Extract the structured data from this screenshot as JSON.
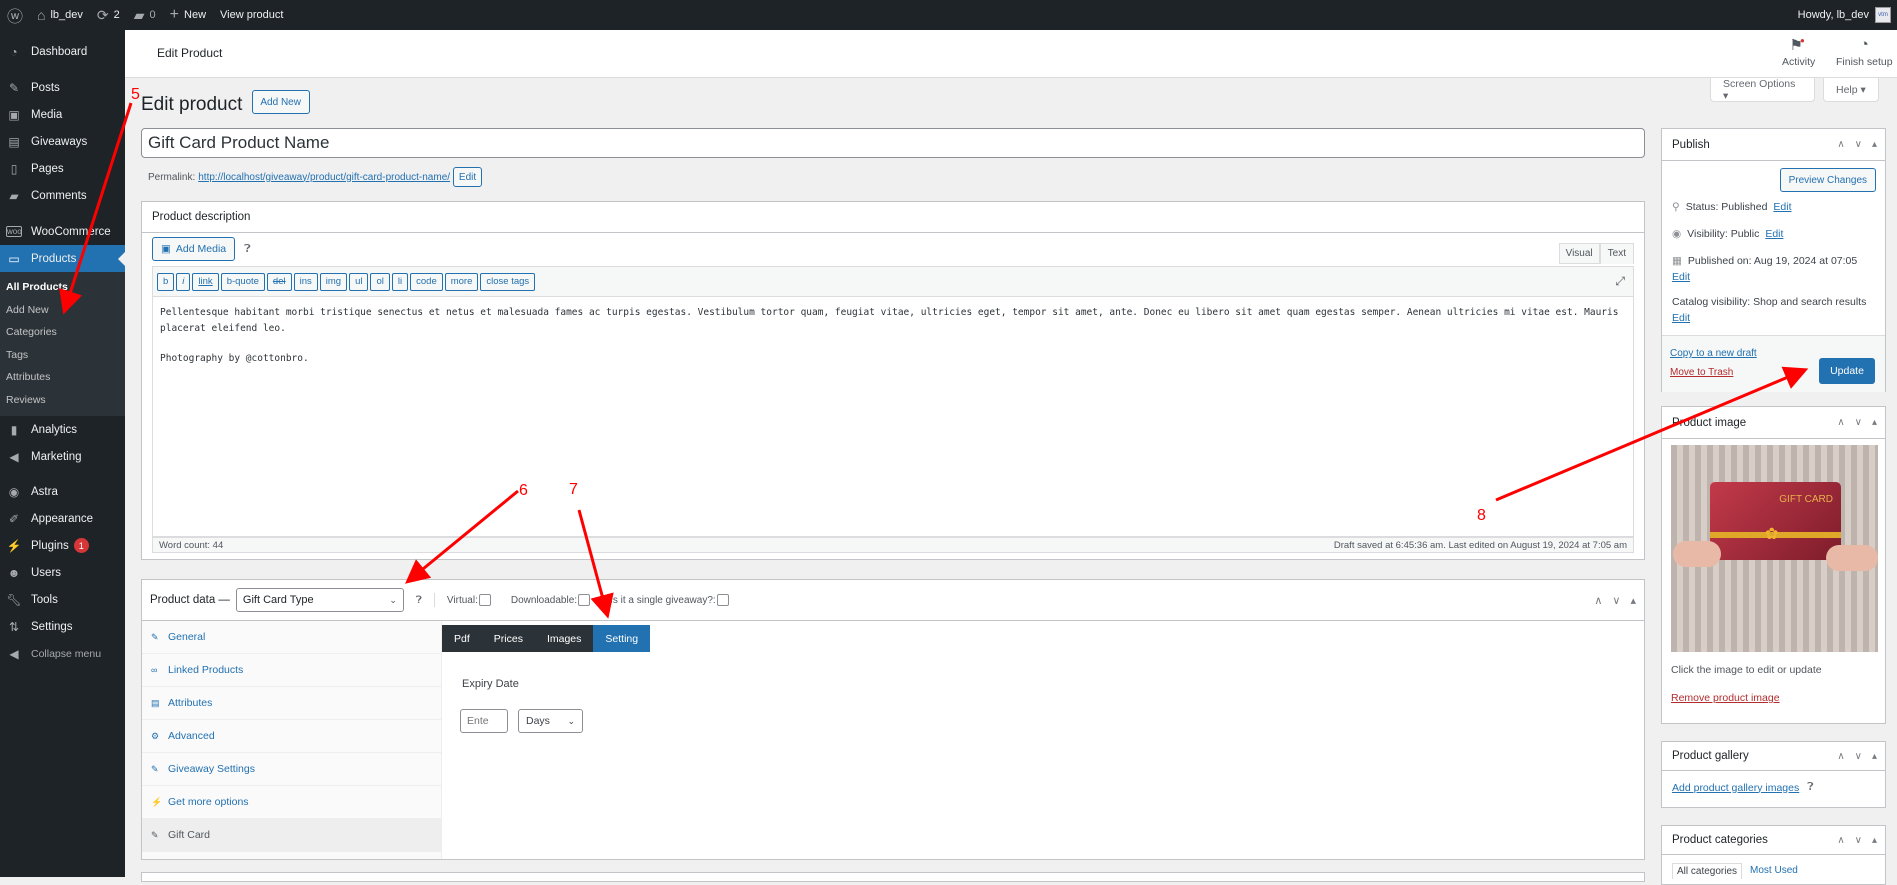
{
  "adminbar": {
    "site_name": "lb_dev",
    "updates_count": "2",
    "comments_count": "0",
    "new_label": "New",
    "view_label": "View product",
    "howdy": "Howdy, lb_dev",
    "avatar_text": "vtm"
  },
  "sidebar": {
    "items": [
      {
        "label": "Dashboard",
        "icon": "dashboard-icon"
      },
      {
        "label": "Posts",
        "icon": "pin-icon"
      },
      {
        "label": "Media",
        "icon": "media-icon"
      },
      {
        "label": "Giveaways",
        "icon": "giveaways-icon"
      },
      {
        "label": "Pages",
        "icon": "pages-icon"
      },
      {
        "label": "Comments",
        "icon": "comment-icon"
      },
      {
        "label": "WooCommerce",
        "icon": "woo-icon"
      },
      {
        "label": "Products",
        "icon": "archive-icon"
      },
      {
        "label": "Analytics",
        "icon": "bar-chart-icon"
      },
      {
        "label": "Marketing",
        "icon": "megaphone-icon"
      },
      {
        "label": "Astra",
        "icon": "astra-icon"
      },
      {
        "label": "Appearance",
        "icon": "brush-icon"
      },
      {
        "label": "Plugins",
        "icon": "plug-icon",
        "badge": "1"
      },
      {
        "label": "Users",
        "icon": "user-icon"
      },
      {
        "label": "Tools",
        "icon": "wrench-icon"
      },
      {
        "label": "Settings",
        "icon": "settings-icon"
      }
    ],
    "submenu": [
      "All Products",
      "Add New",
      "Categories",
      "Tags",
      "Attributes",
      "Reviews"
    ],
    "collapse_label": "Collapse menu"
  },
  "header": {
    "title": "Edit Product",
    "activity_label": "Activity",
    "finish_setup_label": "Finish setup",
    "screen_options": "Screen Options ▾",
    "help": "Help ▾"
  },
  "page": {
    "title": "Edit product",
    "add_new": "Add New",
    "product_name": "Gift Card Product Name",
    "permalink_label": "Permalink:",
    "permalink_url": "http://localhost/giveaway/product/gift-card-product-name/",
    "permalink_edit": "Edit"
  },
  "description": {
    "title": "Product description",
    "add_media": "Add Media",
    "tab_visual": "Visual",
    "tab_text": "Text",
    "quicktags": [
      "b",
      "i",
      "link",
      "b-quote",
      "del",
      "ins",
      "img",
      "ul",
      "ol",
      "li",
      "code",
      "more",
      "close tags"
    ],
    "content_p1": "Pellentesque habitant morbi tristique senectus et netus et malesuada fames ac turpis egestas. Vestibulum tortor quam, feugiat vitae, ultricies eget, tempor sit amet, ante. Donec eu libero sit amet quam egestas semper. Aenean ultricies mi vitae est. Mauris placerat eleifend leo.",
    "content_p2": "Photography by @cottonbro.",
    "word_count": "Word count: 44",
    "draft_status": "Draft saved at 6:45:36 am. Last edited on August 19, 2024 at 7:05 am"
  },
  "product_data": {
    "label": "Product data —",
    "type_selected": "Gift Card Type",
    "virtual_label": "Virtual:",
    "downloadable_label": "Downloadable:",
    "giveaway_label": "Is it a single giveaway?:",
    "virtual_checked": false,
    "downloadable_checked": false,
    "giveaway_checked": false,
    "tabs": [
      {
        "label": "General",
        "icon": "wrench-icon"
      },
      {
        "label": "Linked Products",
        "icon": "link-icon"
      },
      {
        "label": "Attributes",
        "icon": "list-icon"
      },
      {
        "label": "Advanced",
        "icon": "gear-icon"
      },
      {
        "label": "Giveaway Settings",
        "icon": "wrench-icon"
      },
      {
        "label": "Get more options",
        "icon": "plug-icon"
      },
      {
        "label": "Gift Card",
        "icon": "wrench-icon"
      }
    ],
    "giftcard_tabs": [
      "Pdf",
      "Prices",
      "Images",
      "Setting"
    ],
    "expiry_label": "Expiry Date",
    "expiry_placeholder": "Ente",
    "expiry_unit": "Days"
  },
  "publish": {
    "title": "Publish",
    "preview": "Preview Changes",
    "status": "Status: Published",
    "visibility": "Visibility: Public",
    "published_on": "Published on: Aug 19, 2024 at 07:05",
    "catalog": "Catalog visibility: Shop and search results",
    "edit": "Edit",
    "copy_draft": "Copy to a new draft",
    "trash": "Move to Trash",
    "update": "Update"
  },
  "product_image": {
    "title": "Product image",
    "card_text": "GIFT CARD",
    "hint": "Click the image to edit or update",
    "remove": "Remove product image"
  },
  "gallery": {
    "title": "Product gallery",
    "add": "Add product gallery images"
  },
  "categories": {
    "title": "Product categories",
    "tab_all": "All categories",
    "tab_most": "Most Used"
  },
  "annotations": [
    "5",
    "6",
    "7",
    "8"
  ],
  "colors": {
    "accent": "#2271b1",
    "annotation": "#ff0000",
    "adminbar": "#1d2327"
  }
}
